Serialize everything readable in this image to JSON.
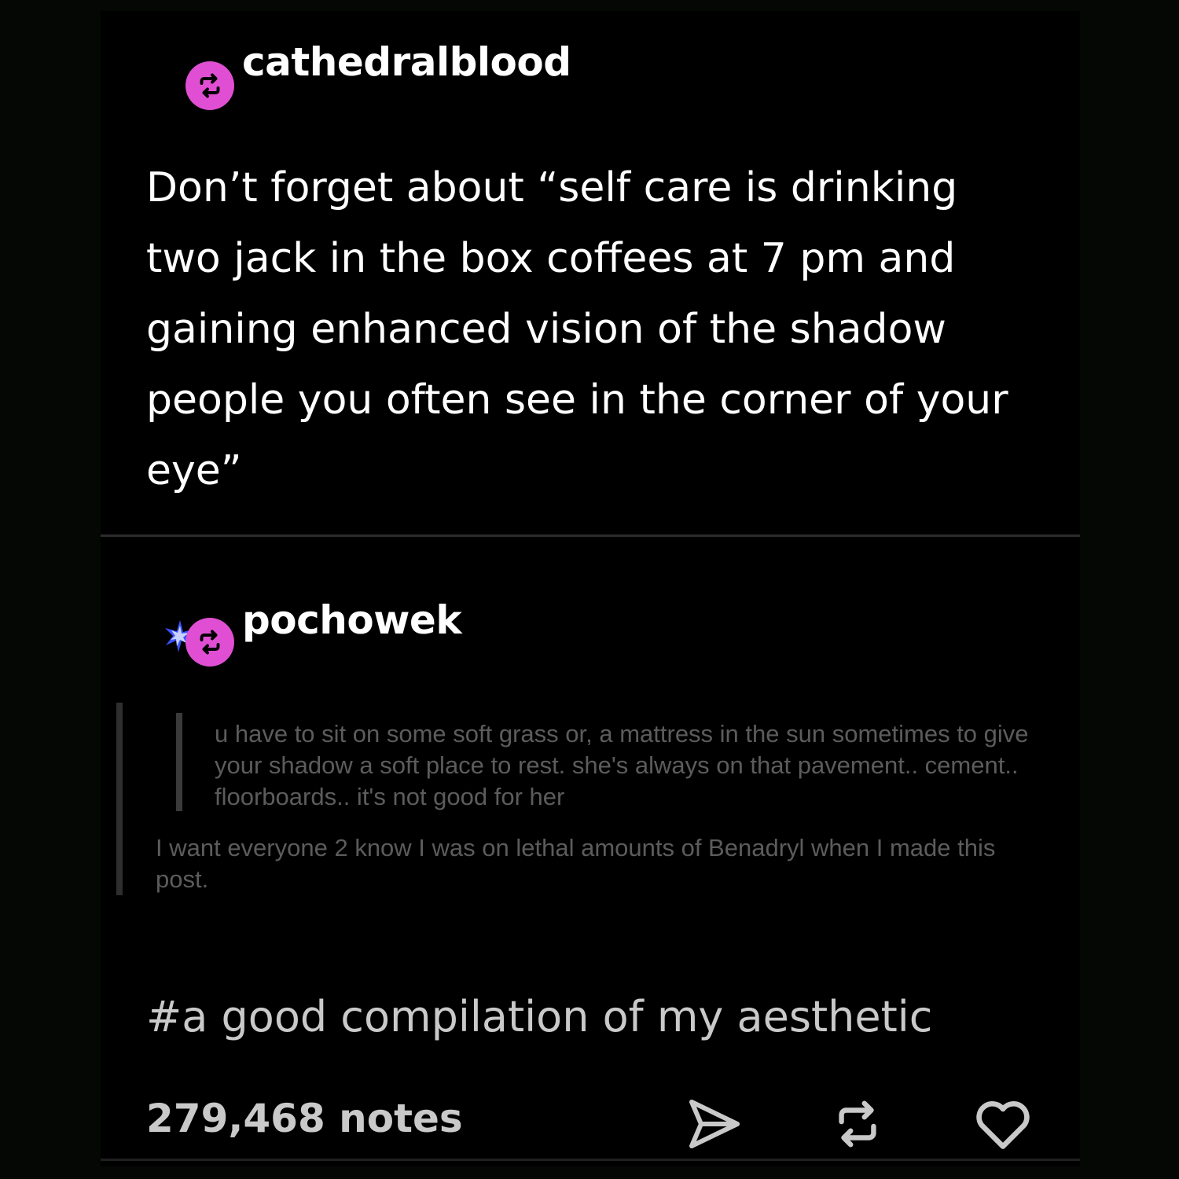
{
  "colors": {
    "background": "#000000",
    "avatar": "#e04fd3",
    "divider": "#2c2c2c",
    "primary_text": "#ffffff",
    "muted_text": "#5c5c5c",
    "footer_text": "#c9c9c9",
    "sparkle": "#3a53ff"
  },
  "posts": [
    {
      "username": "cathedralblood",
      "avatar_icon": "reblog-icon",
      "body": "Don’t forget about “self care is drinking two jack in the box coffees at 7 pm and gaining enhanced vision of the shadow people you often see in the corner of your eye”"
    },
    {
      "username": "pochowek",
      "avatar_icon": "reblog-icon",
      "avatar_decoration": "sparkle-icon",
      "quote": "u have to sit on some soft grass or, a mattress in the sun sometimes to give your shadow a soft place to rest. she's always on that pavement.. cement.. floorboards.. it's not good for her",
      "reply": "I want everyone 2 know I was on lethal amounts of Benadryl when I made this post."
    }
  ],
  "tags": [
    "#a good compilation of my aesthetic"
  ],
  "footer": {
    "notes": "279,468 notes",
    "actions": [
      "share-icon",
      "reblog-icon",
      "heart-icon"
    ]
  }
}
